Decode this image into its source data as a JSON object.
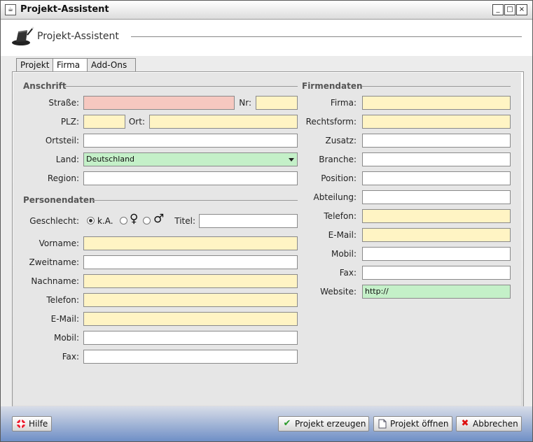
{
  "window": {
    "title": "Projekt-Assistent"
  },
  "header": {
    "title": "Projekt-Assistent"
  },
  "tabs": [
    "Projekt",
    "Firma",
    "Add-Ons"
  ],
  "anschrift": {
    "section": "Anschrift",
    "strasse": {
      "label": "Straße:",
      "value": ""
    },
    "nr": {
      "label": "Nr:",
      "value": ""
    },
    "plz": {
      "label": "PLZ:",
      "value": ""
    },
    "ort": {
      "label": "Ort:",
      "value": ""
    },
    "ortsteil": {
      "label": "Ortsteil:",
      "value": ""
    },
    "land": {
      "label": "Land:",
      "value": "Deutschland"
    },
    "region": {
      "label": "Region:",
      "value": ""
    }
  },
  "personendaten": {
    "section": "Personendaten",
    "geschlecht": {
      "label": "Geschlecht:",
      "options": [
        "k.A.",
        "♀",
        "♂"
      ],
      "selected": "k.A."
    },
    "titel": {
      "label": "Titel:",
      "value": ""
    },
    "vorname": {
      "label": "Vorname:",
      "value": ""
    },
    "zweitname": {
      "label": "Zweitname:",
      "value": ""
    },
    "nachname": {
      "label": "Nachname:",
      "value": ""
    },
    "telefon": {
      "label": "Telefon:",
      "value": ""
    },
    "email": {
      "label": "E-Mail:",
      "value": ""
    },
    "mobil": {
      "label": "Mobil:",
      "value": ""
    },
    "fax": {
      "label": "Fax:",
      "value": ""
    }
  },
  "firmendaten": {
    "section": "Firmendaten",
    "firma": {
      "label": "Firma:",
      "value": ""
    },
    "rechtsform": {
      "label": "Rechtsform:",
      "value": ""
    },
    "zusatz": {
      "label": "Zusatz:",
      "value": ""
    },
    "branche": {
      "label": "Branche:",
      "value": ""
    },
    "position": {
      "label": "Position:",
      "value": ""
    },
    "abteilung": {
      "label": "Abteilung:",
      "value": ""
    },
    "telefon": {
      "label": "Telefon:",
      "value": ""
    },
    "email": {
      "label": "E-Mail:",
      "value": ""
    },
    "mobil": {
      "label": "Mobil:",
      "value": ""
    },
    "fax": {
      "label": "Fax:",
      "value": ""
    },
    "website": {
      "label": "Website:",
      "value": "http://"
    }
  },
  "buttons": {
    "hilfe": "Hilfe",
    "erzeugen": "Projekt erzeugen",
    "oeffnen": "Projekt öffnen",
    "abbrechen": "Abbrechen"
  },
  "colors": {
    "required": "#fff4c4",
    "error": "#f6c8c0",
    "valid": "#c4f0c8",
    "bottom_band": "#6f8fc6"
  },
  "icons": [
    "java-icon",
    "magic-hat-icon",
    "lifebuoy-icon",
    "checkmark-icon",
    "document-icon",
    "cancel-icon"
  ]
}
